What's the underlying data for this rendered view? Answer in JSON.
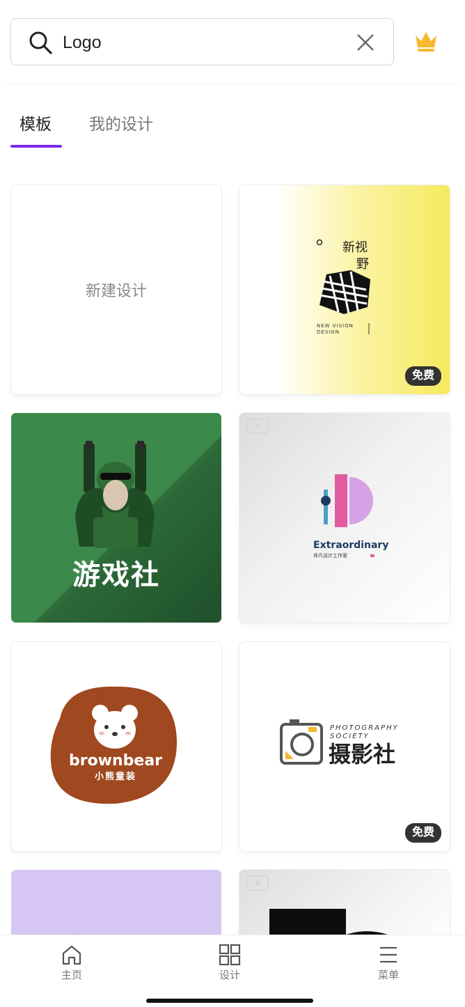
{
  "search": {
    "value": "Logo",
    "placeholder": ""
  },
  "tabs": [
    {
      "label": "模板",
      "active": true
    },
    {
      "label": "我的设计",
      "active": false
    }
  ],
  "colors": {
    "accent": "#7d2ae8",
    "crown": "#f5b82e"
  },
  "cards": {
    "new_design": {
      "label": "新建设计"
    },
    "new_vision": {
      "title_line1": "新视",
      "title_line2": "野",
      "subtitle_line1": "NEW VISION",
      "subtitle_line2": "DESIGN",
      "badge": "免费"
    },
    "game_club": {
      "title": "游戏社"
    },
    "extraordinary": {
      "title": "Extraordinary",
      "subtitle": "非凡设计工作室"
    },
    "brownbear": {
      "title": "brownbear",
      "subtitle": "小熊童装"
    },
    "photography": {
      "title_en_line1": "PHOTOGRAPHY",
      "title_en_line2": "SOCIETY",
      "title_cn": "摄影社",
      "badge": "免费"
    }
  },
  "nav": {
    "home": "主页",
    "designs": "设计",
    "menu": "菜单"
  }
}
